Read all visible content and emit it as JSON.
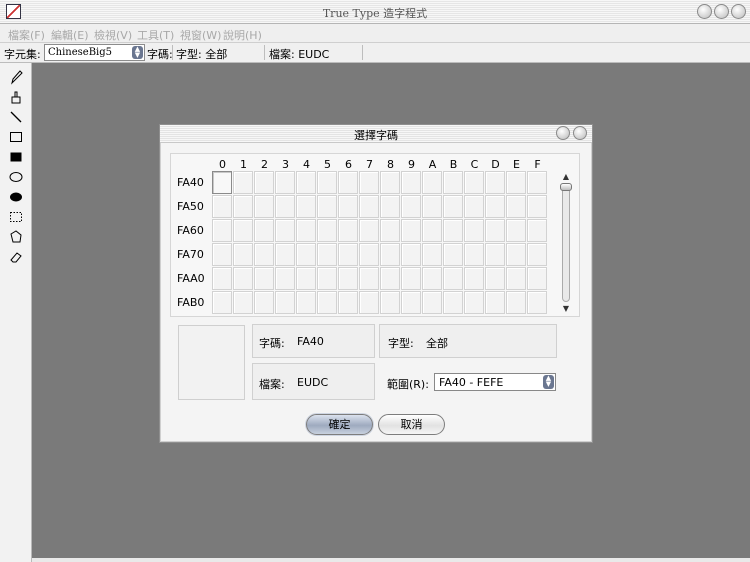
{
  "window": {
    "title": "True Type 造字程式"
  },
  "menu": [
    {
      "label": "檔案(F)"
    },
    {
      "label": "編輯(E)"
    },
    {
      "label": "檢視(V)"
    },
    {
      "label": "工具(T)"
    },
    {
      "label": "視窗(W)"
    },
    {
      "label": "說明(H)"
    }
  ],
  "toolbar": {
    "charset_label": "字元集:",
    "charset_value": "ChineseBig5",
    "code_label": "字碼:",
    "font_label": "字型: 全部",
    "file_label": "檔案: EUDC"
  },
  "tools": [
    "pencil-icon",
    "brush-icon",
    "line-icon",
    "rectangle-icon",
    "filled-rectangle-icon",
    "ellipse-icon",
    "filled-ellipse-icon",
    "rect-select-icon",
    "freeform-select-icon",
    "eraser-icon"
  ],
  "dialog": {
    "title": "選擇字碼",
    "columns": [
      "0",
      "1",
      "2",
      "3",
      "4",
      "5",
      "6",
      "7",
      "8",
      "9",
      "A",
      "B",
      "C",
      "D",
      "E",
      "F"
    ],
    "rows": [
      "FA40",
      "FA50",
      "FA60",
      "FA70",
      "FAA0",
      "FAB0"
    ],
    "selected_cell": "FA40",
    "code_label": "字碼:",
    "code_value": "FA40",
    "font_label": "字型:",
    "font_value": "全部",
    "file_label": "檔案:",
    "file_value": "EUDC",
    "range_label": "範圍(R):",
    "range_value": "FA40 - FEFE",
    "ok_label": "確定",
    "cancel_label": "取消"
  }
}
